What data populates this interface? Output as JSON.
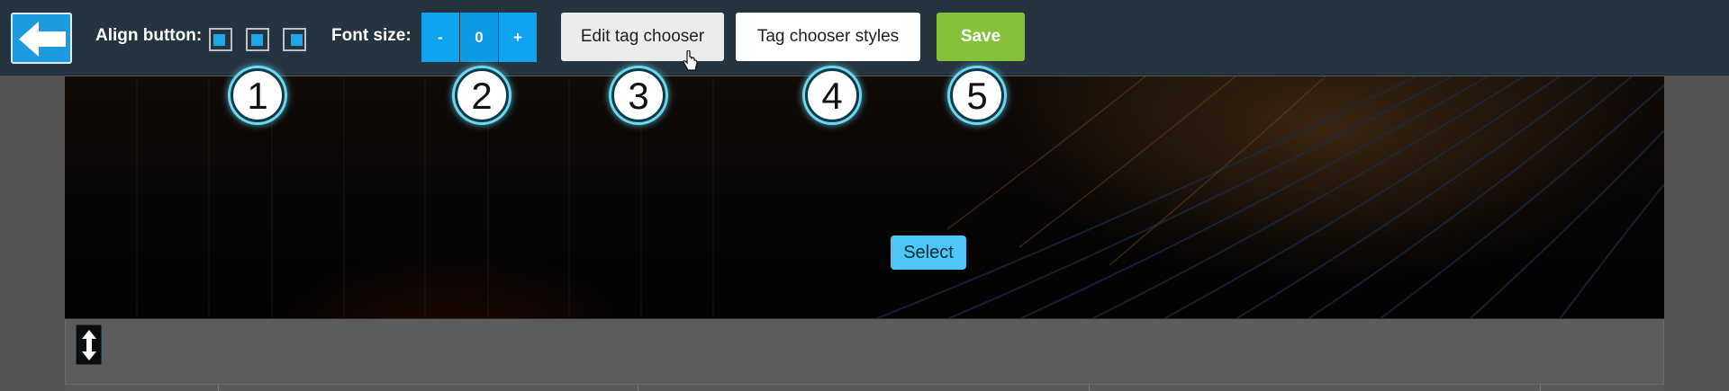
{
  "toolbar": {
    "align_label": "Align button:",
    "align_options": [
      "align-left",
      "align-center",
      "align-right"
    ],
    "font_size_label": "Font size:",
    "font_decrease": "-",
    "font_value": "0",
    "font_increase": "+",
    "edit_tag_chooser": "Edit tag chooser",
    "tag_chooser_styles": "Tag chooser styles",
    "save": "Save"
  },
  "hero": {
    "select_button": "Select"
  },
  "callouts": [
    "1",
    "2",
    "3",
    "4",
    "5"
  ],
  "colors": {
    "toolbar_bg": "#25343f",
    "accent_blue": "#10a4f0",
    "save_green": "#85c23a",
    "select_blue": "#4dc6f5"
  },
  "icons": {
    "back": "arrow-left-icon",
    "resize": "vertical-resize-icon",
    "cursor": "hand-pointer-icon"
  }
}
